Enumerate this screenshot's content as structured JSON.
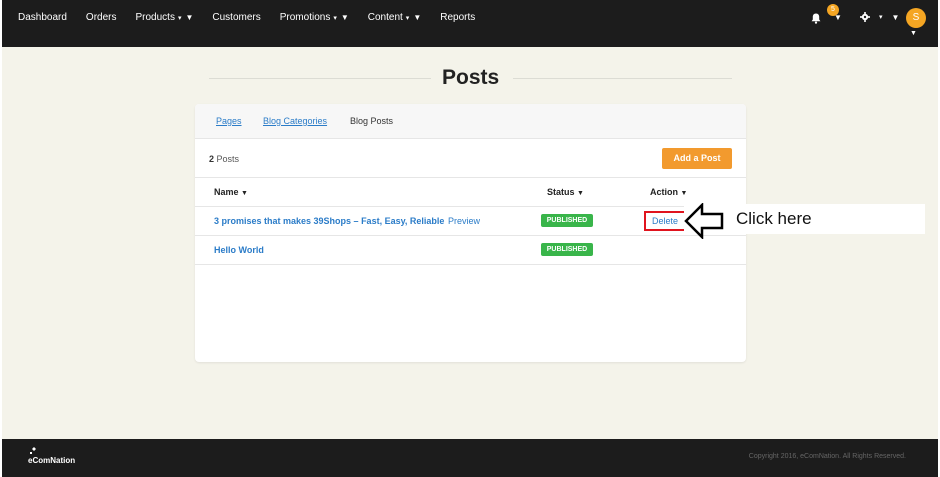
{
  "nav": {
    "items": [
      {
        "label": "Dashboard",
        "caret": false,
        "dropdown": false
      },
      {
        "label": "Orders",
        "caret": false,
        "dropdown": false
      },
      {
        "label": "Products",
        "caret": true,
        "dropdown": true
      },
      {
        "label": "Customers",
        "caret": false,
        "dropdown": false
      },
      {
        "label": "Promotions",
        "caret": true,
        "dropdown": true
      },
      {
        "label": "Content",
        "caret": true,
        "dropdown": true
      },
      {
        "label": "Reports",
        "caret": false,
        "dropdown": false
      }
    ],
    "notification_count": "5",
    "avatar_initial": "S",
    "icons": [
      "bell-icon",
      "gear-icon",
      "chevron-down-icon"
    ]
  },
  "page": {
    "title": "Posts"
  },
  "card": {
    "tabs": [
      {
        "label": "Pages",
        "active": false
      },
      {
        "label": "Blog Categories",
        "active": false
      },
      {
        "label": "Blog Posts",
        "active": true
      }
    ],
    "count": "2",
    "count_label": "Posts",
    "add_button": "Add a Post",
    "columns": {
      "name": "Name",
      "status": "Status",
      "action": "Action"
    },
    "rows": [
      {
        "name": "3 promises that makes 39Shops – Fast, Easy, Reliable",
        "preview": "Preview",
        "status": "PUBLISHED",
        "action": "Delete"
      },
      {
        "name": "Hello World",
        "preview": "",
        "status": "PUBLISHED",
        "action": ""
      }
    ]
  },
  "annotation": {
    "text": "Click here",
    "highlight_color": "#e0141e"
  },
  "footer": {
    "logo": "eComNation",
    "copyright": "Copyright 2016, eComNation. All Rights Reserved."
  },
  "colors": {
    "topbar": "#1c1c1c",
    "background": "#f4f3ea",
    "accent": "#f29a2e",
    "link": "#2b7cc8",
    "published": "#39b54a"
  }
}
